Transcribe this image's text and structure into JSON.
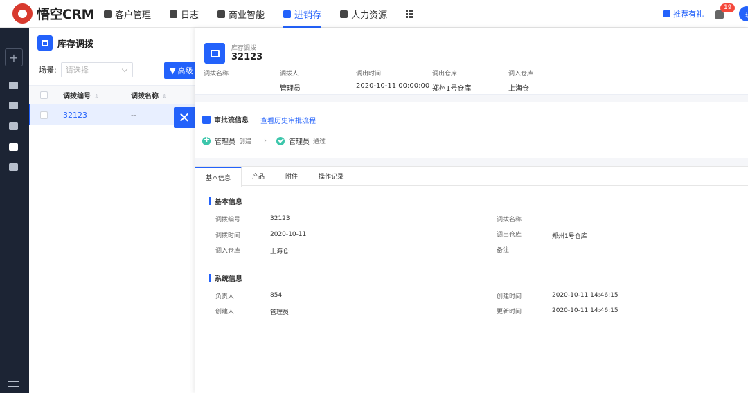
{
  "topbar": {
    "logo_text": "悟空CRM",
    "nav": [
      {
        "label": "客户管理",
        "active": false
      },
      {
        "label": "日志",
        "active": false
      },
      {
        "label": "商业智能",
        "active": false
      },
      {
        "label": "进销存",
        "active": true
      },
      {
        "label": "人力资源",
        "active": false
      }
    ],
    "gift_label": "推荐有礼",
    "notification_count": "19",
    "avatar_text": "理"
  },
  "list": {
    "title": "库存调拨",
    "filter_label": "场景:",
    "filter_placeholder": "请选择",
    "advanced_button": "高级",
    "columns": [
      "调拨编号",
      "调拨名称"
    ],
    "rows": [
      {
        "number": "32123",
        "name": "--"
      }
    ]
  },
  "detail": {
    "subtitle": "库存调拨",
    "title": "32123",
    "header_fields": [
      {
        "label": "调拨名称",
        "value": ""
      },
      {
        "label": "调拨人",
        "value": "管理员"
      },
      {
        "label": "调出时间",
        "value": "2020-10-11 00:00:00"
      },
      {
        "label": "调出仓库",
        "value": "郑州1号仓库"
      },
      {
        "label": "调入仓库",
        "value": "上海仓"
      }
    ],
    "approval": {
      "title": "审批流信息",
      "history_link": "查看历史审批流程",
      "steps": [
        {
          "name": "管理员",
          "status": "创建"
        },
        {
          "name": "管理员",
          "status": "通过"
        }
      ]
    },
    "tabs": [
      "基本信息",
      "产品",
      "附件",
      "操作记录"
    ],
    "basic_section": {
      "title": "基本信息",
      "left": [
        {
          "label": "调拨编号",
          "value": "32123"
        },
        {
          "label": "调拨时间",
          "value": "2020-10-11"
        },
        {
          "label": "调入仓库",
          "value": "上海仓"
        }
      ],
      "right": [
        {
          "label": "调拨名称",
          "value": ""
        },
        {
          "label": "调出仓库",
          "value": "郑州1号仓库"
        },
        {
          "label": "备注",
          "value": ""
        }
      ]
    },
    "system_section": {
      "title": "系统信息",
      "left": [
        {
          "label": "负责人",
          "value": "854"
        },
        {
          "label": "创建人",
          "value": "管理员"
        }
      ],
      "right": [
        {
          "label": "创建时间",
          "value": "2020-10-11 14:46:15"
        },
        {
          "label": "更新时间",
          "value": "2020-10-11 14:46:15"
        }
      ]
    }
  },
  "colors": {
    "accent": "#2362fb",
    "sidebar": "#1c2434",
    "success": "#3cc6ab",
    "badge": "#f5483b"
  }
}
